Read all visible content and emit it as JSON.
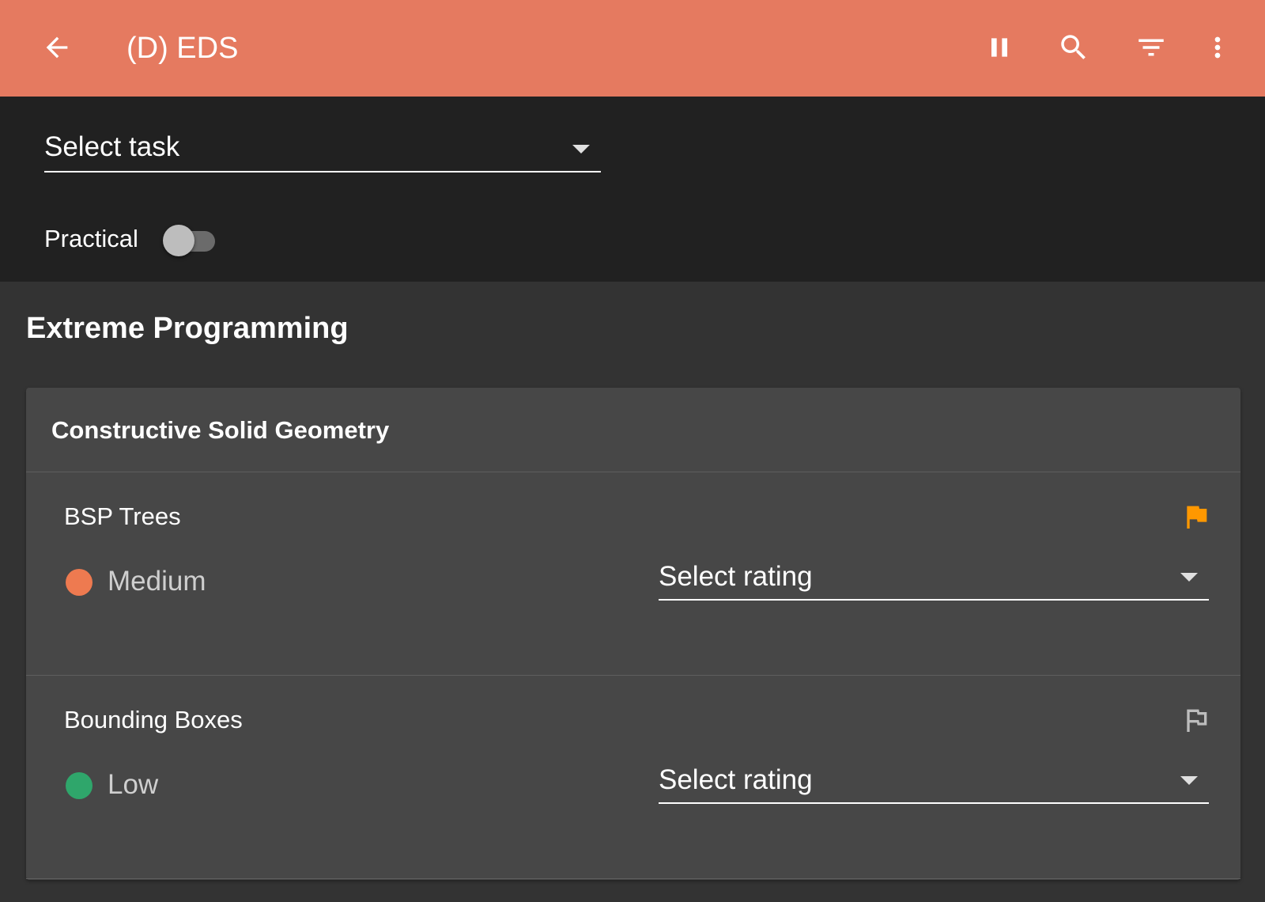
{
  "appbar": {
    "title": "(D) EDS",
    "background": "#e57a60",
    "icons": [
      "arrow-back-icon",
      "pause-icon",
      "search-icon",
      "filter-icon",
      "more-vert-icon"
    ]
  },
  "filters": {
    "task_select": {
      "value": "Select task"
    },
    "practical": {
      "label": "Practical",
      "enabled": false
    }
  },
  "section": {
    "title": "Extreme Programming",
    "card": {
      "title": "Constructive Solid Geometry",
      "items": [
        {
          "name": "BSP Trees",
          "flagged": true,
          "flag_color": "#ff9800",
          "level": "Medium",
          "level_color": "#ee7a50",
          "rating_select": "Select rating"
        },
        {
          "name": "Bounding Boxes",
          "flagged": false,
          "flag_color": "#bdbdbd",
          "level": "Low",
          "level_color": "#2fa66b",
          "rating_select": "Select rating"
        }
      ]
    }
  }
}
